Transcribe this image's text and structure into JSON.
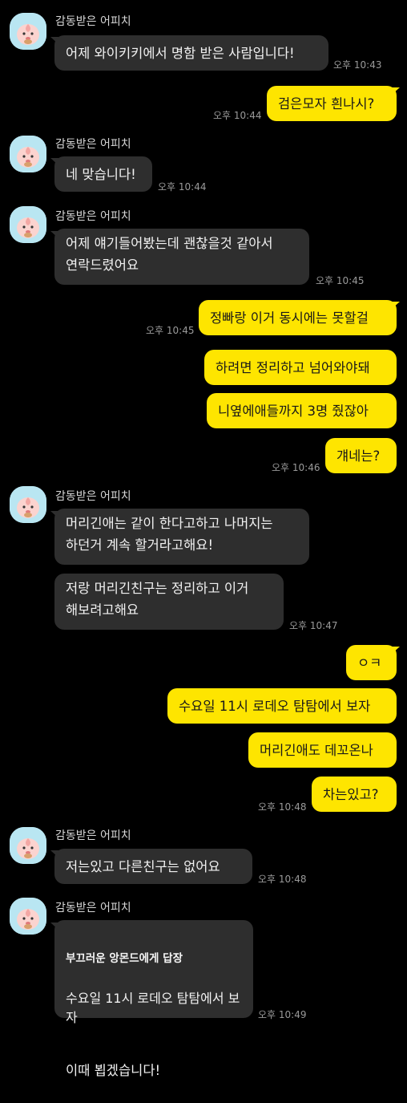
{
  "sender_name": "감동받은 어피치",
  "messages": [
    {
      "text": "어제 와이키키에서 명함 받은 사람입니다!",
      "time": "오후 10:43"
    },
    {
      "text": "검은모자 흰나시?",
      "time": "오후 10:44"
    },
    {
      "text": "네 맞습니다!",
      "time": "오후 10:44"
    },
    {
      "text": "어제 얘기들어봤는데 괜찮을것 같아서\n연락드렸어요",
      "time": "오후 10:45"
    },
    {
      "text": "정빠랑 이거 동시에는 못할걸",
      "time": "오후 10:45"
    },
    {
      "text": "하려면 정리하고 넘어와야돼"
    },
    {
      "text": "니옆에애들까지 3명 줬잖아"
    },
    {
      "text": "걔네는?",
      "time": "오후 10:46"
    },
    {
      "text": "머리긴애는 같이 한다고하고 나머지는\n하던거 계속 할거라고해요!"
    },
    {
      "text": "저랑 머리긴친구는 정리하고 이거\n해보려고해요",
      "time": "오후 10:47"
    },
    {
      "text": "ㅇㅋ"
    },
    {
      "text": "수요일 11시 로데오 탐탐에서 보자"
    },
    {
      "text": "머리긴애도 데꼬온나"
    },
    {
      "text": "차는있고?",
      "time": "오후 10:48"
    },
    {
      "text": "저는있고 다른친구는 없어요",
      "time": "오후 10:48"
    },
    {
      "reply_title": "부끄러운 앙몬드에게 답장",
      "reply_quote": "수요일 11시 로데오 탐탐에서 보자",
      "text": "이때 뵙겠습니다!",
      "time": "오후 10:49"
    }
  ],
  "colors": {
    "background": "#000000",
    "incoming_bubble": "#2e2e2e",
    "outgoing_bubble": "#fee500",
    "avatar_bg": "#b9e6f2",
    "timestamp": "#9a9a9a"
  },
  "avatar_icon": "apeach-profile-icon"
}
